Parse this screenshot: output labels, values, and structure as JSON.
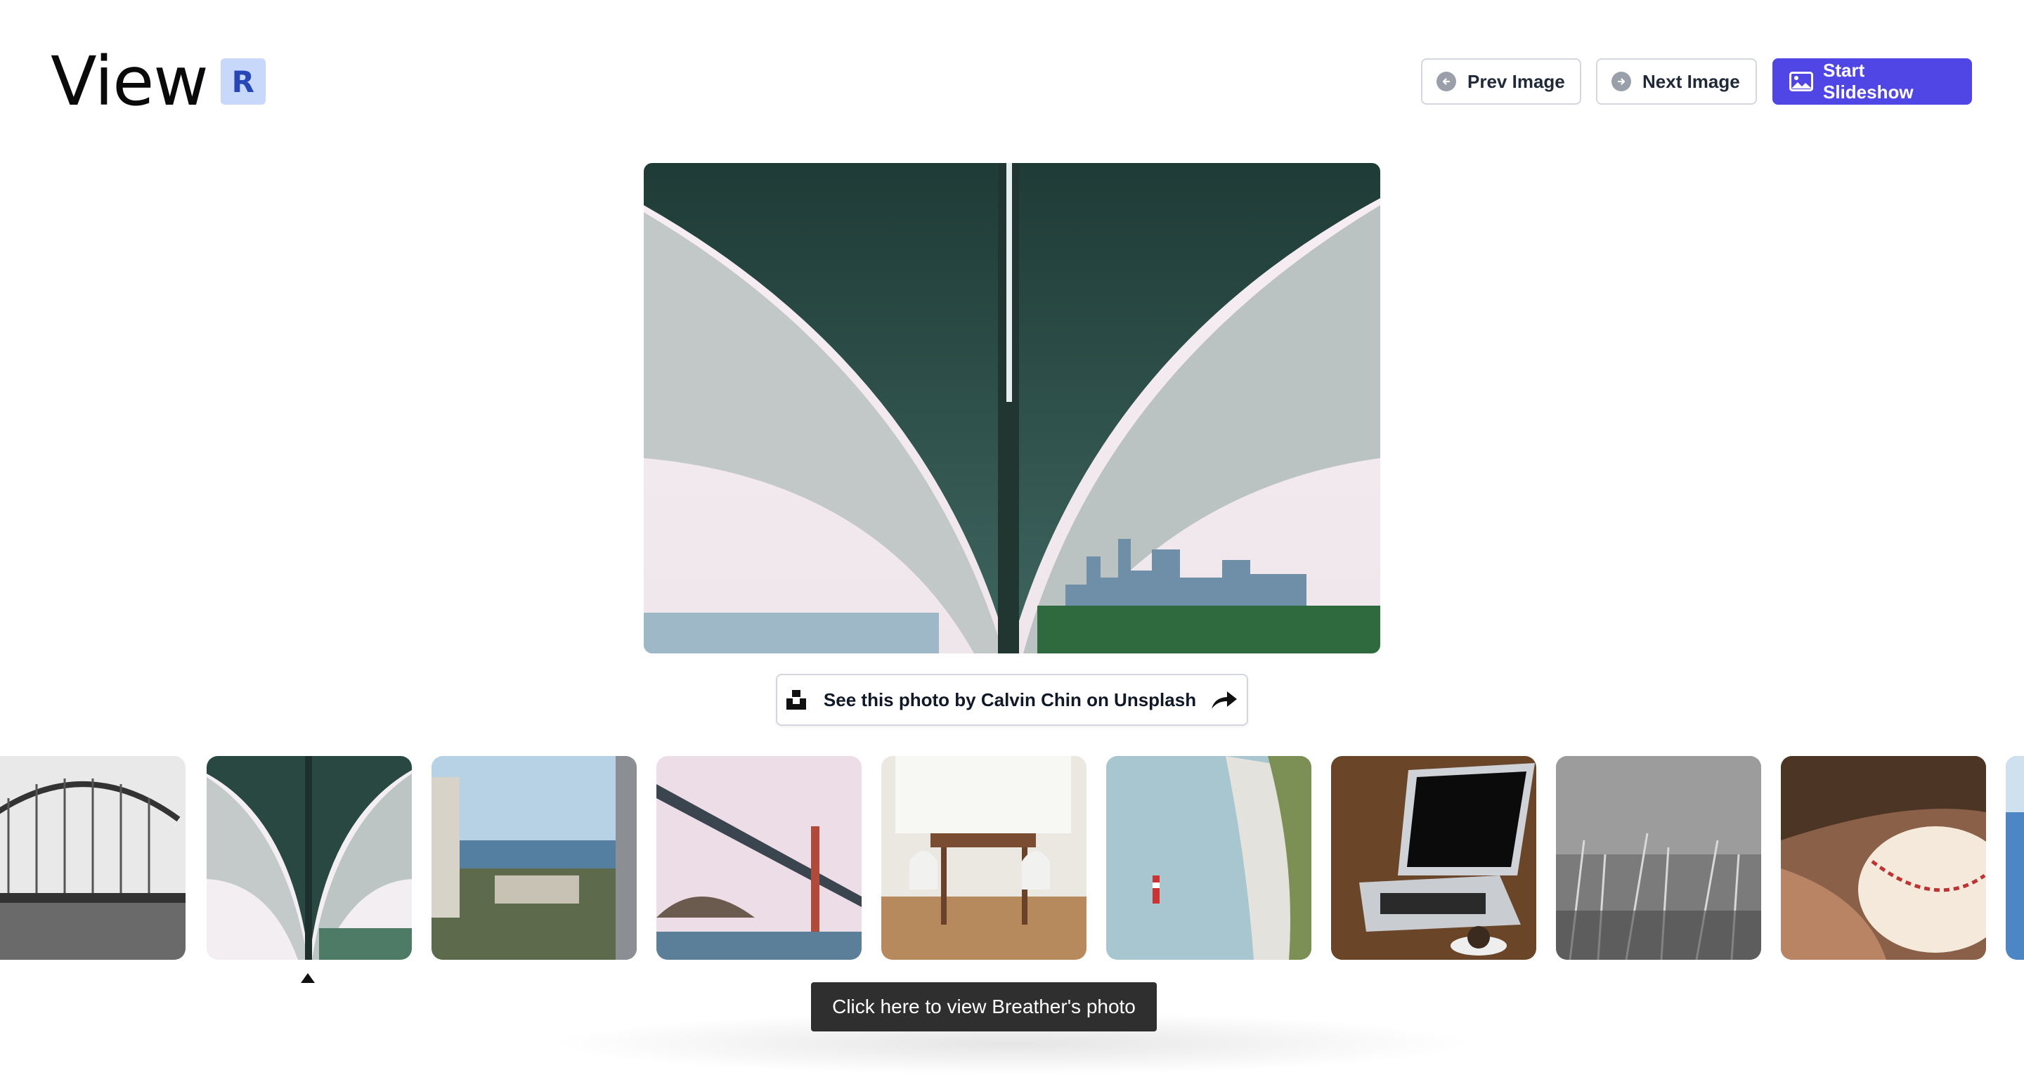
{
  "header": {
    "logo_text": "View",
    "logo_badge": "R",
    "prev_label": "Prev Image",
    "next_label": "Next Image",
    "slideshow_label": "Start Slideshow"
  },
  "colors": {
    "accent": "#4f46e5",
    "badge_bg": "#c7d8fb",
    "badge_text": "#2747b7",
    "tooltip_bg": "#2f2f2f"
  },
  "main_photo": {
    "subject": "underside of bridge"
  },
  "credit": {
    "label": "See this photo by Calvin Chin on Unsplash",
    "icon": "unsplash-icon",
    "action_icon": "share-arrow-icon"
  },
  "thumbnails": [
    {
      "subject": "arched bridge black and white",
      "selected": false
    },
    {
      "subject": "underside of bridge",
      "selected": true
    },
    {
      "subject": "coastal buildings",
      "selected": false
    },
    {
      "subject": "golden gate bridge",
      "selected": false
    },
    {
      "subject": "dining table and chairs",
      "selected": false
    },
    {
      "subject": "lighthouse by cliff",
      "selected": false
    },
    {
      "subject": "laptop and coffee",
      "selected": false
    },
    {
      "subject": "grass black and white",
      "selected": false
    },
    {
      "subject": "baseball glove",
      "selected": false
    },
    {
      "subject": "ocean",
      "selected": false
    }
  ],
  "tooltip": {
    "text": "Click here to view Breather's photo"
  }
}
